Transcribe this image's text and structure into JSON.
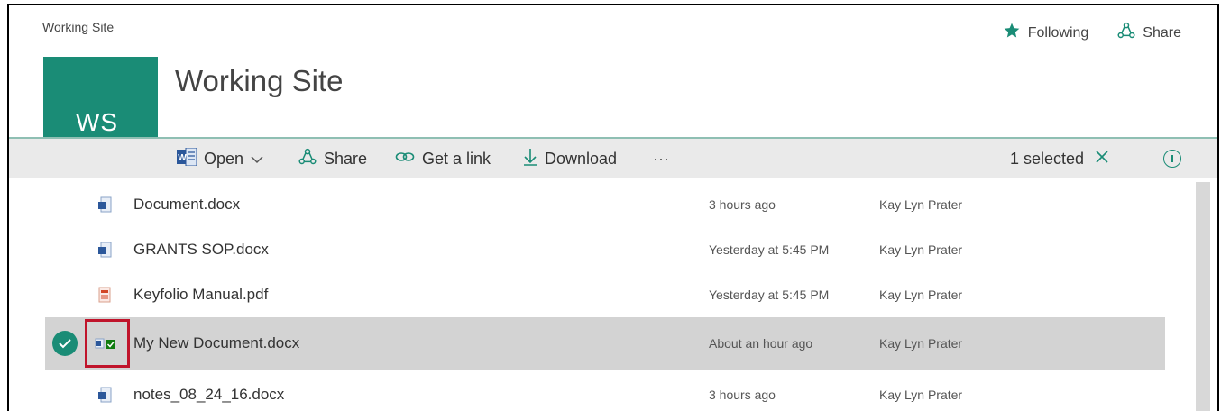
{
  "header": {
    "breadcrumb": "Working Site",
    "site_title": "Working Site",
    "logo_initials": "WS",
    "following_label": "Following",
    "share_label": "Share"
  },
  "commandbar": {
    "open_label": "Open",
    "share_label": "Share",
    "get_link_label": "Get a link",
    "download_label": "Download",
    "more_label": "···",
    "selection_status": "1 selected"
  },
  "files": [
    {
      "name": "Document.docx",
      "modified": "3 hours ago",
      "author": "Kay Lyn Prater",
      "type": "word",
      "selected": false
    },
    {
      "name": "GRANTS SOP.docx",
      "modified": "Yesterday at 5:45 PM",
      "author": "Kay Lyn Prater",
      "type": "word",
      "selected": false
    },
    {
      "name": "Keyfolio Manual.pdf",
      "modified": "Yesterday at 5:45 PM",
      "author": "Kay Lyn Prater",
      "type": "pdf",
      "selected": false
    },
    {
      "name": "My New Document.docx",
      "modified": "About an hour ago",
      "author": "Kay Lyn Prater",
      "type": "word-checked-out",
      "selected": true
    },
    {
      "name": "notes_08_24_16.docx",
      "modified": "3 hours ago",
      "author": "Kay Lyn Prater",
      "type": "word",
      "selected": false
    }
  ],
  "colors": {
    "accent": "#1a8c76",
    "selected_row": "#d3d3d3",
    "highlight_box": "#c0142b",
    "word_blue": "#2b579a",
    "pdf_red": "#d24726"
  }
}
